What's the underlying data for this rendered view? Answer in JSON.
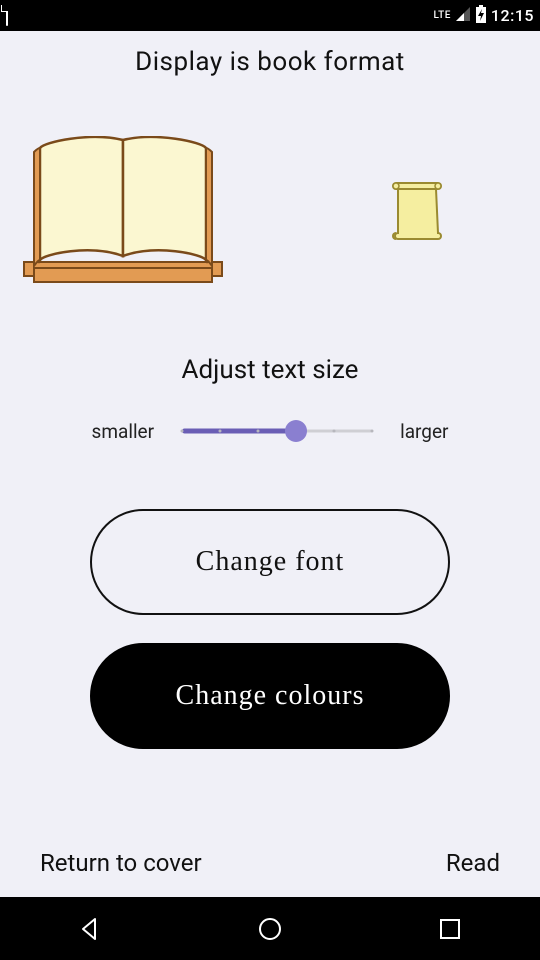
{
  "status": {
    "clock": "12:15",
    "lte": "LTE"
  },
  "title": "Display is book format",
  "textSizeHeading": "Adjust text size",
  "slider": {
    "smaller": "smaller",
    "larger": "larger"
  },
  "buttons": {
    "changeFont": "Change font",
    "changeColours": "Change colours"
  },
  "footer": {
    "returnToCover": "Return to cover",
    "read": "Read"
  }
}
